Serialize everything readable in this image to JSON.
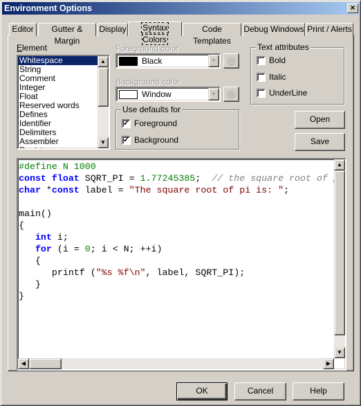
{
  "window": {
    "title": "Environment Options",
    "close_icon": "close-icon"
  },
  "tabs": [
    {
      "label": "Editor"
    },
    {
      "label": "Gutter & Margin"
    },
    {
      "label": "Display"
    },
    {
      "label": "Syntax Colors",
      "active": true
    },
    {
      "label": "Code Templates"
    },
    {
      "label": "Debug Windows"
    },
    {
      "label": "Print / Alerts"
    }
  ],
  "element": {
    "label": "Element",
    "items": [
      "Whitespace",
      "String",
      "Comment",
      "Integer",
      "Float",
      "Reserved words",
      "Defines",
      "Identifier",
      "Delimiters",
      "Assembler",
      "Register"
    ],
    "selected": "Whitespace"
  },
  "foreground": {
    "label": "Foreground color",
    "value": "Black",
    "swatch": "#000000"
  },
  "background": {
    "label": "Background color",
    "value": "Window",
    "swatch": "#ffffff"
  },
  "use_defaults": {
    "title": "Use defaults for",
    "foreground": {
      "label": "Foreground",
      "checked": true
    },
    "background": {
      "label": "Background",
      "checked": true
    }
  },
  "text_attributes": {
    "title": "Text attributes",
    "bold": {
      "label": "Bold",
      "checked": false
    },
    "italic": {
      "label": "Italic",
      "checked": false
    },
    "underline": {
      "label": "UnderLine",
      "checked": false
    }
  },
  "buttons": {
    "open": "Open",
    "save": "Save",
    "ok": "OK",
    "cancel": "Cancel",
    "help": "Help"
  },
  "colors": {
    "title_start": "#0a246a",
    "title_end": "#a6caf0",
    "keyword": "#0000ff",
    "number": "#008000",
    "string": "#800000",
    "comment": "#808080",
    "selection": "#0a246a"
  },
  "code": [
    [
      [
        "pre",
        "#define N 1000"
      ]
    ],
    [
      [
        "kw",
        "const"
      ],
      [
        "id",
        " "
      ],
      [
        "kw",
        "float"
      ],
      [
        "id",
        " SQRT_PI = "
      ],
      [
        "num",
        "1.77245385"
      ],
      [
        "id",
        ";  "
      ],
      [
        "com",
        "// the square root of pi"
      ]
    ],
    [
      [
        "kw",
        "char"
      ],
      [
        "id",
        " *"
      ],
      [
        "kw",
        "const"
      ],
      [
        "id",
        " label = "
      ],
      [
        "str",
        "\"The square root of pi is: \""
      ],
      [
        "id",
        ";"
      ]
    ],
    [
      [
        "id",
        ""
      ]
    ],
    [
      [
        "id",
        "main()"
      ]
    ],
    [
      [
        "id",
        "{"
      ]
    ],
    [
      [
        "id",
        "   "
      ],
      [
        "kw",
        "int"
      ],
      [
        "id",
        " i;"
      ]
    ],
    [
      [
        "id",
        "   "
      ],
      [
        "kw",
        "for"
      ],
      [
        "id",
        " (i = "
      ],
      [
        "num",
        "0"
      ],
      [
        "id",
        "; i < N; ++i)"
      ]
    ],
    [
      [
        "id",
        "   {"
      ]
    ],
    [
      [
        "id",
        "      printf ("
      ],
      [
        "str",
        "\"%s %f\\n\""
      ],
      [
        "id",
        ", label, SQRT_PI);"
      ]
    ],
    [
      [
        "id",
        "   }"
      ]
    ],
    [
      [
        "id",
        "}"
      ]
    ]
  ]
}
